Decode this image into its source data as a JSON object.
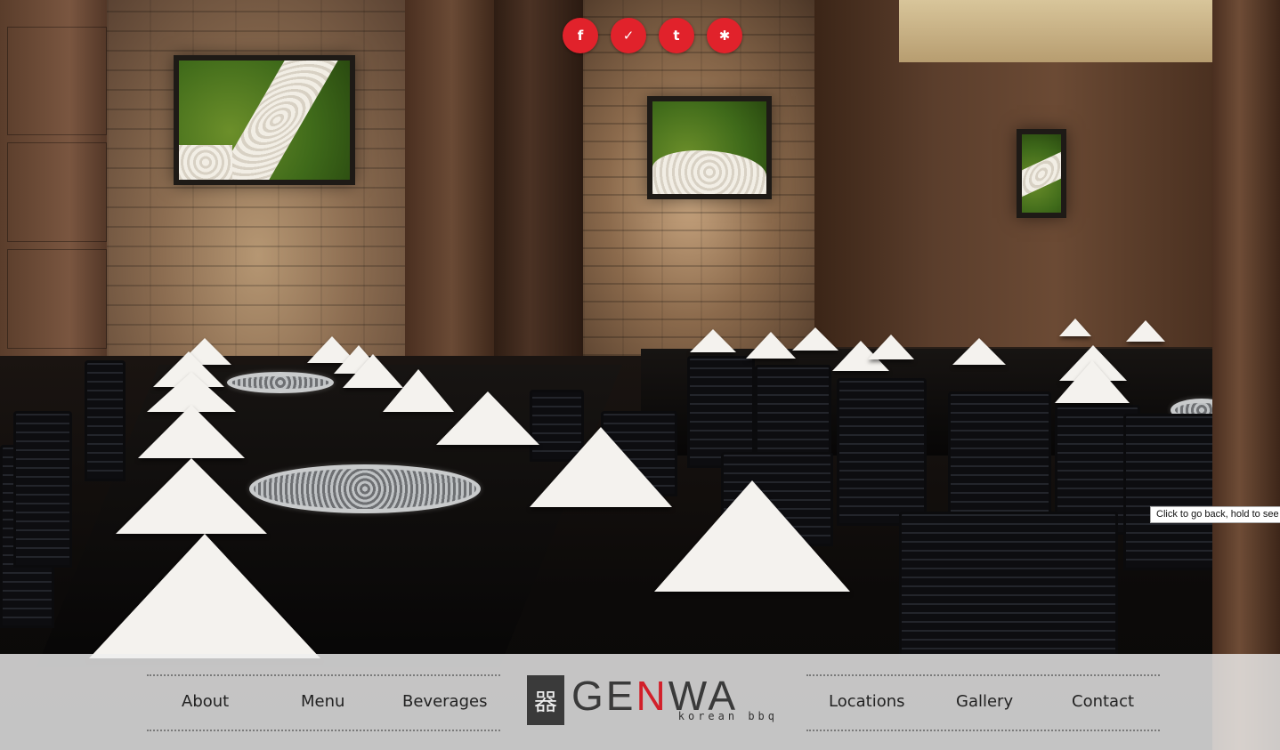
{
  "social": [
    {
      "name": "facebook",
      "icon": "facebook-icon",
      "glyph": "f"
    },
    {
      "name": "foursquare",
      "icon": "foursquare-icon",
      "glyph": "✓"
    },
    {
      "name": "tumblr",
      "icon": "tumblr-icon",
      "glyph": "t"
    },
    {
      "name": "yelp",
      "icon": "yelp-icon",
      "glyph": "✱"
    }
  ],
  "nav": {
    "left": [
      "About",
      "Menu",
      "Beverages"
    ],
    "right": [
      "Locations",
      "Gallery",
      "Contact"
    ]
  },
  "logo": {
    "mark": "器",
    "word_start": "GE",
    "word_accent": "N",
    "word_end": "WA",
    "tagline": "korean bbq"
  },
  "tooltip": "Click to go back, hold to see history",
  "colors": {
    "accent": "#e1222b",
    "navbar_bg": "#eeeeee",
    "logo_gray": "#3a3a3a"
  }
}
